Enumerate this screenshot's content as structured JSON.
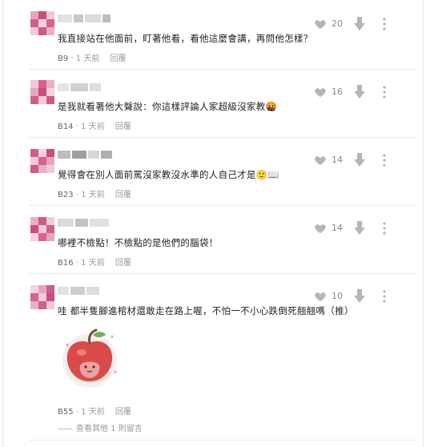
{
  "comments": [
    {
      "text": "我直接站在他面前，盯著他看，看他這麼會講，再問他怎樣？",
      "floor": "B9",
      "time": "1 天前",
      "likes": "20",
      "reply": "回覆"
    },
    {
      "text": "是我就看著他大聲說：你這樣評論人家超級沒家教🤬",
      "floor": "B14",
      "time": "1 天前",
      "likes": "16",
      "reply": "回覆"
    },
    {
      "text": "覺得會在別人面前罵沒家教沒水準的人自己才是🙂📖",
      "floor": "B23",
      "time": "1 天前",
      "likes": "14",
      "reply": "回覆"
    },
    {
      "text": "哪裡不檢點！不檢點的是他們的腦袋！",
      "floor": "B16",
      "time": "1 天前",
      "likes": "14",
      "reply": "回覆"
    },
    {
      "text": "哇 都半隻腳進棺材還敢走在路上喔，不怕一不小心跌倒死翹翹嗎（推）",
      "floor": "B55",
      "time": "1 天前",
      "likes": "10",
      "reply": "回覆"
    }
  ],
  "separator": "·",
  "more_replies": "查看其他 1 則留言",
  "colors": {
    "icon": "#b5b5b5",
    "avatar_pink": "#d9618f",
    "sticker_red": "#d94a4a"
  }
}
